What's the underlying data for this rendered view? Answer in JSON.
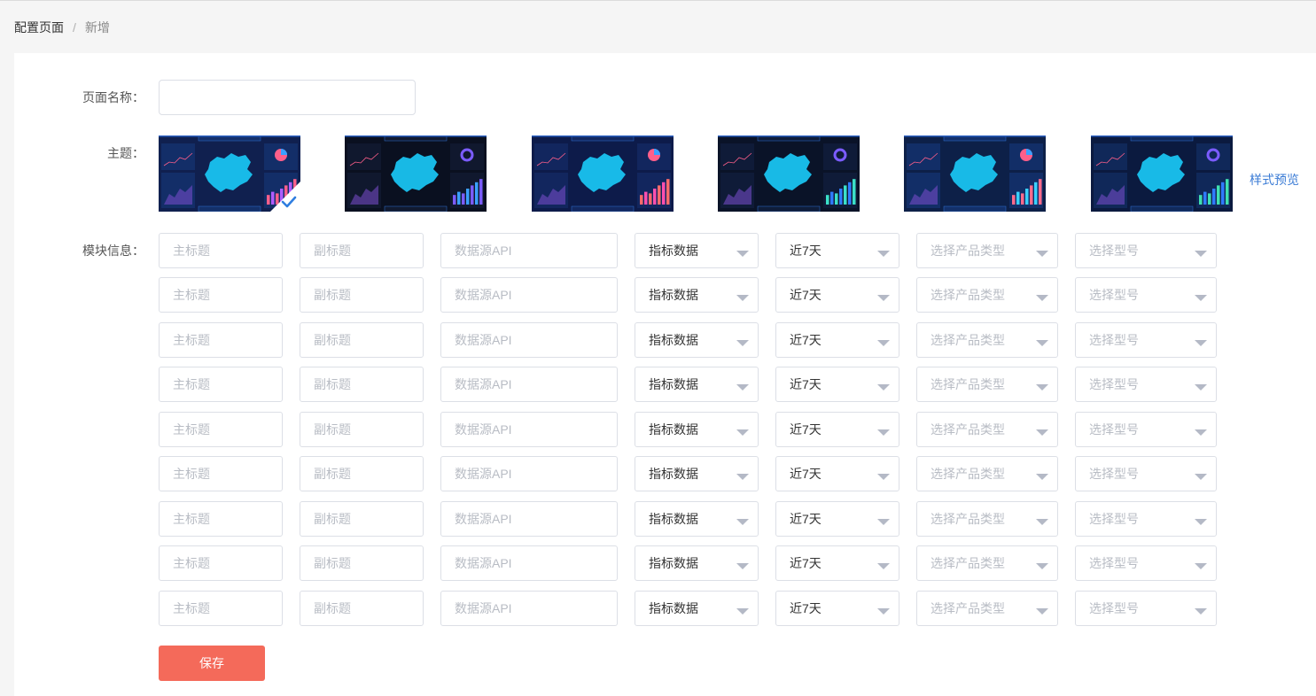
{
  "breadcrumb": {
    "parent": "配置页面",
    "separator": "/",
    "current": "新增"
  },
  "form": {
    "page_name_label": "页面名称：",
    "page_name_value": "",
    "theme_label": "主题：",
    "module_label": "模块信息：",
    "preview_link": "样式预览",
    "save_button": "保存"
  },
  "themes": [
    {
      "selected": true
    },
    {
      "selected": false
    },
    {
      "selected": false
    },
    {
      "selected": false
    },
    {
      "selected": false
    },
    {
      "selected": false
    }
  ],
  "module_placeholders": {
    "title": "主标题",
    "subtitle": "副标题",
    "api": "数据源API"
  },
  "modules": [
    {
      "data_type": "指标数据",
      "period": "近7天",
      "product_type": "选择产品类型",
      "model": "选择型号"
    },
    {
      "data_type": "指标数据",
      "period": "近7天",
      "product_type": "选择产品类型",
      "model": "选择型号"
    },
    {
      "data_type": "指标数据",
      "period": "近7天",
      "product_type": "选择产品类型",
      "model": "选择型号"
    },
    {
      "data_type": "指标数据",
      "period": "近7天",
      "product_type": "选择产品类型",
      "model": "选择型号"
    },
    {
      "data_type": "指标数据",
      "period": "近7天",
      "product_type": "选择产品类型",
      "model": "选择型号"
    },
    {
      "data_type": "指标数据",
      "period": "近7天",
      "product_type": "选择产品类型",
      "model": "选择型号"
    },
    {
      "data_type": "指标数据",
      "period": "近7天",
      "product_type": "选择产品类型",
      "model": "选择型号"
    },
    {
      "data_type": "指标数据",
      "period": "近7天",
      "product_type": "选择产品类型",
      "model": "选择型号"
    },
    {
      "data_type": "指标数据",
      "period": "近7天",
      "product_type": "选择产品类型",
      "model": "选择型号"
    }
  ],
  "colors": {
    "accent_link": "#3a7bd5",
    "save_button": "#f46a5a",
    "theme_map": "#19c3f0",
    "check_badge": "#ffffff"
  }
}
